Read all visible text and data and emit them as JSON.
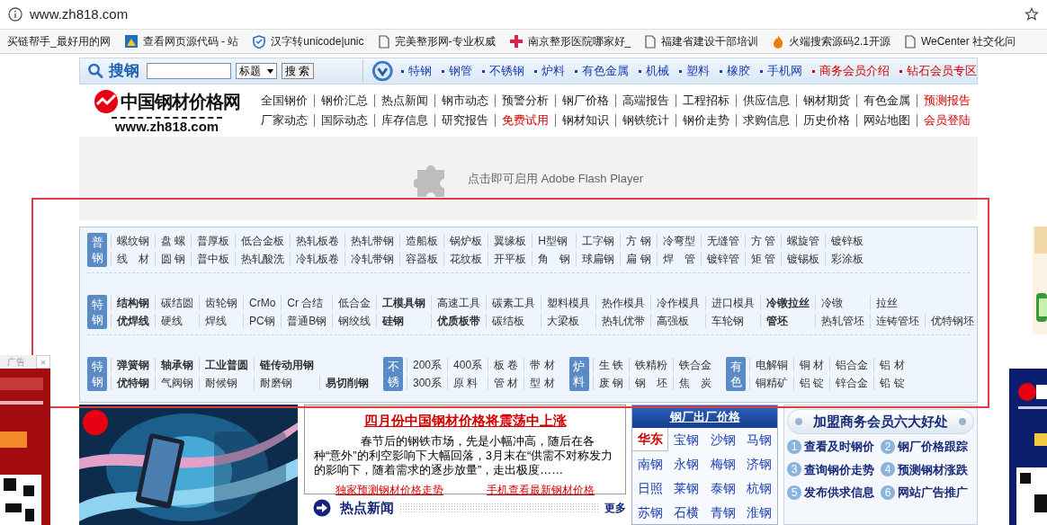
{
  "browser": {
    "url": "www.zh818.com",
    "bookmarks": [
      {
        "kind": "none",
        "text": "买链帮手_最好用的网"
      },
      {
        "kind": "chart",
        "text": "查看网页源代码 - 站"
      },
      {
        "kind": "shield",
        "text": "汉字转unicode|unic"
      },
      {
        "kind": "page",
        "text": "完美整形网-专业权威"
      },
      {
        "kind": "logo",
        "text": "南京整形医院哪家好_"
      },
      {
        "kind": "page",
        "text": "福建省建设干部培训"
      },
      {
        "kind": "flame",
        "text": "火端搜索源码2.1开源"
      },
      {
        "kind": "page",
        "text": "WeCenter 社交化问"
      }
    ]
  },
  "search_bar": {
    "logo": "搜钢",
    "select": "标题",
    "button": "搜 索",
    "links": [
      {
        "text": "特钢",
        "highlight": false
      },
      {
        "text": "钢管",
        "highlight": false
      },
      {
        "text": "不锈钢",
        "highlight": false
      },
      {
        "text": "炉料",
        "highlight": false
      },
      {
        "text": "有色金属",
        "highlight": false
      },
      {
        "text": "机械",
        "highlight": false
      },
      {
        "text": "塑料",
        "highlight": false
      },
      {
        "text": "橡胶",
        "highlight": false
      },
      {
        "text": "手机网",
        "highlight": false
      },
      {
        "text": "商务会员介绍",
        "highlight": true
      },
      {
        "text": "钻石会员专区",
        "highlight": true
      }
    ]
  },
  "header": {
    "logo_text": "中国钢材价格网",
    "logo_url": "www.zh818.com",
    "nav_rows": [
      [
        {
          "text": "全国钢价",
          "highlight": false
        },
        {
          "text": "钢价汇总",
          "highlight": false
        },
        {
          "text": "热点新闻",
          "highlight": false
        },
        {
          "text": "钢市动态",
          "highlight": false
        },
        {
          "text": "预警分析",
          "highlight": false
        },
        {
          "text": "钢厂价格",
          "highlight": false
        },
        {
          "text": "高端报告",
          "highlight": false
        },
        {
          "text": "工程招标",
          "highlight": false
        },
        {
          "text": "供应信息",
          "highlight": false
        },
        {
          "text": "钢材期货",
          "highlight": false
        },
        {
          "text": "有色金属",
          "highlight": false
        },
        {
          "text": "预测报告",
          "highlight": true
        }
      ],
      [
        {
          "text": "厂家动态",
          "highlight": false
        },
        {
          "text": "国际动态",
          "highlight": false
        },
        {
          "text": "库存信息",
          "highlight": false
        },
        {
          "text": "研究报告",
          "highlight": false
        },
        {
          "text": "免费试用",
          "highlight": true
        },
        {
          "text": "钢材知识",
          "highlight": false
        },
        {
          "text": "钢铁统计",
          "highlight": false
        },
        {
          "text": "钢价走势",
          "highlight": false
        },
        {
          "text": "求购信息",
          "highlight": false
        },
        {
          "text": "历史价格",
          "highlight": false
        },
        {
          "text": "网站地图",
          "highlight": false
        },
        {
          "text": "会员登陆",
          "highlight": true
        }
      ]
    ]
  },
  "flash": {
    "text": "点击即可启用 Adobe Flash Player"
  },
  "categories": [
    {
      "sections": [
        {
          "badge": "普钢",
          "rows": [
            [
              {
                "text": "螺纹钢",
                "bold": false
              },
              {
                "text": "盘 螺",
                "bold": false
              },
              {
                "text": "普厚板",
                "bold": false
              },
              {
                "text": "低合金板",
                "bold": false
              },
              {
                "text": "热轧板卷",
                "bold": false
              },
              {
                "text": "热轧带钢",
                "bold": false
              },
              {
                "text": "造船板",
                "bold": false
              },
              {
                "text": "锅炉板",
                "bold": false
              },
              {
                "text": "翼缘板",
                "bold": false
              },
              {
                "text": "H型钢",
                "bold": false
              },
              {
                "text": "工字钢",
                "bold": false
              },
              {
                "text": "方 钢",
                "bold": false
              },
              {
                "text": "冷弯型",
                "bold": false
              },
              {
                "text": "无缝管",
                "bold": false
              },
              {
                "text": "方 管",
                "bold": false
              },
              {
                "text": "螺旋管",
                "bold": false
              },
              {
                "text": "镀锌板",
                "bold": false
              }
            ],
            [
              {
                "text": "线　材",
                "bold": false
              },
              {
                "text": "圆 钢",
                "bold": false
              },
              {
                "text": "普中板",
                "bold": false
              },
              {
                "text": "热轧酸洗",
                "bold": false
              },
              {
                "text": "冷轧板卷",
                "bold": false
              },
              {
                "text": "冷轧带钢",
                "bold": false
              },
              {
                "text": "容器板",
                "bold": false
              },
              {
                "text": "花纹板",
                "bold": false
              },
              {
                "text": "开平板",
                "bold": false
              },
              {
                "text": "角　钢",
                "bold": false
              },
              {
                "text": "球扁钢",
                "bold": false
              },
              {
                "text": "扁 钢",
                "bold": false
              },
              {
                "text": "焊　管",
                "bold": false
              },
              {
                "text": "镀锌管",
                "bold": false
              },
              {
                "text": "矩 管",
                "bold": false
              },
              {
                "text": "镀锡板",
                "bold": false
              },
              {
                "text": "彩涂板",
                "bold": false
              }
            ]
          ]
        }
      ]
    },
    {
      "sections": [
        {
          "badge": "特钢",
          "rows": [
            [
              {
                "text": "结构钢",
                "bold": true
              },
              {
                "text": "碳结圆",
                "bold": false
              },
              {
                "text": "齿轮钢",
                "bold": false
              },
              {
                "text": "CrMo",
                "bold": false
              },
              {
                "text": "Cr 合结",
                "bold": false
              },
              {
                "text": "低合金",
                "bold": false
              },
              {
                "text": "工模具钢",
                "bold": true
              },
              {
                "text": "高速工具",
                "bold": false
              },
              {
                "text": "碳素工具",
                "bold": false
              },
              {
                "text": "塑料模具",
                "bold": false
              },
              {
                "text": "热作模具",
                "bold": false
              },
              {
                "text": "冷作模具",
                "bold": false
              },
              {
                "text": "进口模具",
                "bold": false
              },
              {
                "text": "冷镦拉丝",
                "bold": true
              },
              {
                "text": "冷镦",
                "bold": false
              },
              {
                "text": "拉丝",
                "bold": false
              }
            ],
            [
              {
                "text": "优焊线",
                "bold": true
              },
              {
                "text": "硬线",
                "bold": false
              },
              {
                "text": "焊线",
                "bold": false
              },
              {
                "text": "PC钢",
                "bold": false
              },
              {
                "text": "普通B钢",
                "bold": false
              },
              {
                "text": "钢绞线",
                "bold": false
              },
              {
                "text": "硅钢",
                "bold": true
              },
              {
                "text": "优质板带",
                "bold": true
              },
              {
                "text": "碳结板",
                "bold": false
              },
              {
                "text": "大梁板",
                "bold": false
              },
              {
                "text": "热轧优带",
                "bold": false
              },
              {
                "text": "高强板",
                "bold": false
              },
              {
                "text": "车轮钢",
                "bold": false
              },
              {
                "text": "管坯",
                "bold": true
              },
              {
                "text": "热轧管坯",
                "bold": false
              },
              {
                "text": "连铸管坯",
                "bold": false
              },
              {
                "text": "优特钢坯",
                "bold": false
              }
            ]
          ]
        }
      ]
    },
    {
      "sections": [
        {
          "badge": "特钢",
          "rows": [
            [
              {
                "text": "弹簧钢",
                "bold": true
              },
              {
                "text": "轴承钢",
                "bold": true
              },
              {
                "text": "工业普圆",
                "bold": true
              },
              {
                "text": "链传动用钢",
                "bold": true
              }
            ],
            [
              {
                "text": "优特钢",
                "bold": true
              },
              {
                "text": "气阀钢",
                "bold": false
              },
              {
                "text": "耐候钢",
                "bold": false
              },
              {
                "text": "耐磨钢",
                "bold": false
              },
              {
                "text": "易切削钢",
                "bold": true
              }
            ]
          ]
        },
        {
          "badge": "不锈",
          "rows": [
            [
              {
                "text": "200系",
                "bold": false
              },
              {
                "text": "400系",
                "bold": false
              },
              {
                "text": "板 卷",
                "bold": false
              },
              {
                "text": "带 材",
                "bold": false
              }
            ],
            [
              {
                "text": "300系",
                "bold": false
              },
              {
                "text": "原 料",
                "bold": false
              },
              {
                "text": "管 材",
                "bold": false
              },
              {
                "text": "型 材",
                "bold": false
              }
            ]
          ]
        },
        {
          "badge": "炉料",
          "rows": [
            [
              {
                "text": "生 铁",
                "bold": false
              },
              {
                "text": "铁精粉",
                "bold": false
              },
              {
                "text": "铁合金",
                "bold": false
              }
            ],
            [
              {
                "text": "废 钢",
                "bold": false
              },
              {
                "text": "钢　坯",
                "bold": false
              },
              {
                "text": "焦　炭",
                "bold": false
              }
            ]
          ]
        },
        {
          "badge": "有色",
          "rows": [
            [
              {
                "text": "电解铜",
                "bold": false
              },
              {
                "text": "铜 材",
                "bold": false
              },
              {
                "text": "铝合金",
                "bold": false
              },
              {
                "text": "铝 材",
                "bold": false
              }
            ],
            [
              {
                "text": "铜精矿",
                "bold": false
              },
              {
                "text": "铝 锭",
                "bold": false
              },
              {
                "text": "锌合金",
                "bold": false
              },
              {
                "text": "铅 锭",
                "bold": false
              }
            ]
          ]
        }
      ]
    }
  ],
  "ad": {
    "label": "广告",
    "close": "×"
  },
  "news": {
    "headline": "四月份中国钢材价格将震荡中上涨",
    "body": "春节后的钢铁市场，先是小幅冲高，随后在各种“意外”的利空影响下大幅回落，3月末在“供需不对称发力的影响下，随着需求的逐步放量”，走出极度……",
    "links": [
      "独家预测钢材价格走势",
      "手机查看最新钢材价格"
    ]
  },
  "hot_news": {
    "title": "热点新闻",
    "more": "更多"
  },
  "mill_prices": {
    "title": "钢厂出厂价格",
    "regions": [
      {
        "text": "华东",
        "selected": true
      }
    ],
    "mills": [
      "宝钢",
      "沙钢",
      "马钢",
      "南钢",
      "永钢",
      "梅钢",
      "济钢",
      "日照",
      "莱钢",
      "泰钢",
      "杭钢",
      "苏钢",
      "石横",
      "青钢",
      "淮钢"
    ]
  },
  "benefits": {
    "title": "加盟商务会员六大好处",
    "items": [
      {
        "num": "1",
        "text": "查看及时钢价"
      },
      {
        "num": "2",
        "text": "钢厂价格跟踪"
      },
      {
        "num": "3",
        "text": "查询钢价走势"
      },
      {
        "num": "4",
        "text": "预测钢材涨跌"
      },
      {
        "num": "5",
        "text": "发布供求信息"
      },
      {
        "num": "6",
        "text": "网站广告推广"
      }
    ]
  }
}
